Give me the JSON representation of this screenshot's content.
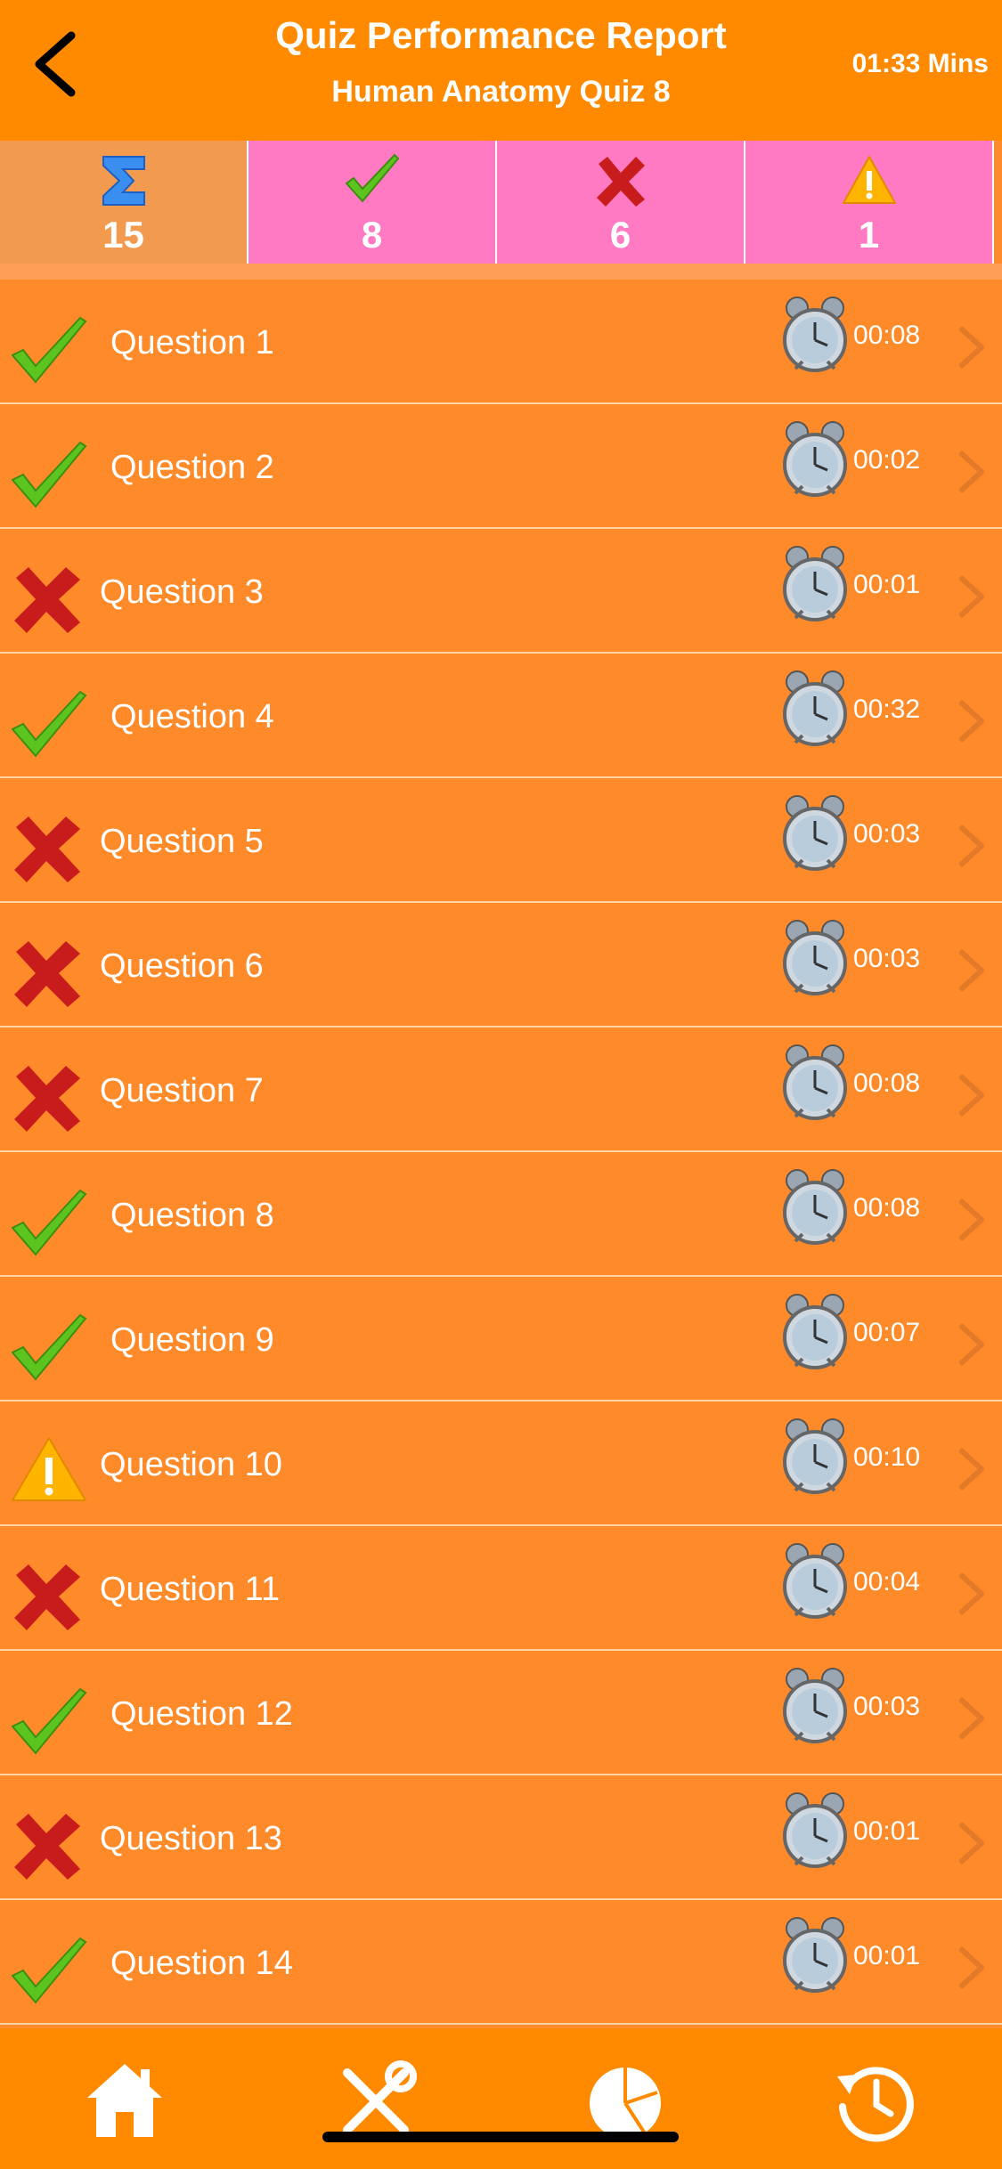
{
  "header": {
    "title": "Quiz Performance Report",
    "subtitle": "Human Anatomy Quiz 8",
    "total_time": "01:33 Mins"
  },
  "stats": {
    "total": "15",
    "correct": "8",
    "wrong": "6",
    "skipped": "1"
  },
  "questions": [
    {
      "label": "Question 1",
      "time": "00:08",
      "status": "correct"
    },
    {
      "label": "Question 2",
      "time": "00:02",
      "status": "correct"
    },
    {
      "label": "Question 3",
      "time": "00:01",
      "status": "wrong"
    },
    {
      "label": "Question 4",
      "time": "00:32",
      "status": "correct"
    },
    {
      "label": "Question 5",
      "time": "00:03",
      "status": "wrong"
    },
    {
      "label": "Question 6",
      "time": "00:03",
      "status": "wrong"
    },
    {
      "label": "Question 7",
      "time": "00:08",
      "status": "wrong"
    },
    {
      "label": "Question 8",
      "time": "00:08",
      "status": "correct"
    },
    {
      "label": "Question 9",
      "time": "00:07",
      "status": "correct"
    },
    {
      "label": "Question 10",
      "time": "00:10",
      "status": "skipped"
    },
    {
      "label": "Question 11",
      "time": "00:04",
      "status": "wrong"
    },
    {
      "label": "Question 12",
      "time": "00:03",
      "status": "correct"
    },
    {
      "label": "Question 13",
      "time": "00:01",
      "status": "wrong"
    },
    {
      "label": "Question 14",
      "time": "00:01",
      "status": "correct"
    }
  ],
  "tabs": [
    "home-icon",
    "tools-icon",
    "pie-chart-icon",
    "history-icon"
  ],
  "colors": {
    "header": "#FF8A00",
    "row": "#FF8A2A",
    "stat_pink": "#FF7AC2",
    "correct_green": "#5CC41E",
    "wrong_red": "#D21E1E"
  }
}
